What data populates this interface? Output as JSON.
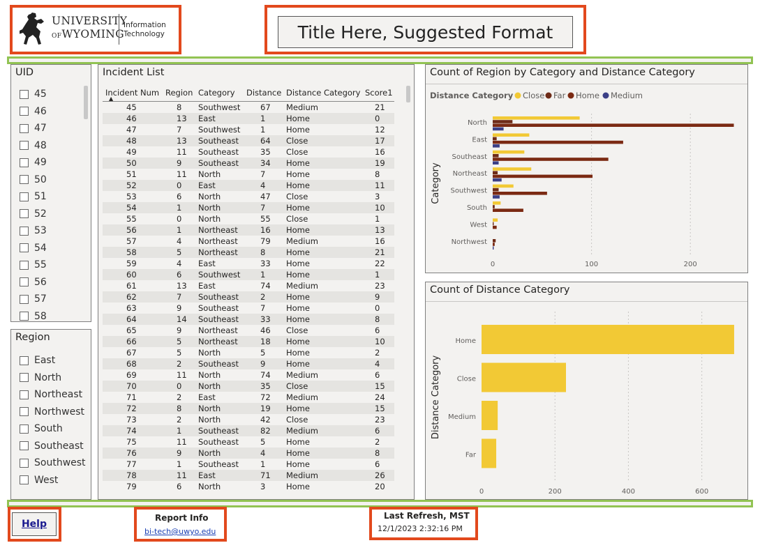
{
  "header": {
    "logo": {
      "line1": "UNIVERSITY",
      "line2_of": "OF",
      "line2": "WYOMING",
      "dept_line1": "Information",
      "dept_line2": "Technology"
    },
    "title": "Title Here, Suggested Format"
  },
  "uid_slicer": {
    "title": "UID",
    "items": [
      "45",
      "46",
      "47",
      "48",
      "49",
      "50",
      "51",
      "52",
      "53",
      "54",
      "55",
      "56",
      "57",
      "58"
    ]
  },
  "region_slicer": {
    "title": "Region",
    "items": [
      "East",
      "North",
      "Northeast",
      "Northwest",
      "South",
      "Southeast",
      "Southwest",
      "West"
    ]
  },
  "incident_list": {
    "title": "Incident List",
    "columns": [
      "Incident Num",
      "Region",
      "Category",
      "Distance",
      "Distance Category",
      "Score1"
    ],
    "sort_indicator": "▲",
    "rows": [
      [
        "45",
        "8",
        "Southwest",
        "67",
        "Medium",
        "21"
      ],
      [
        "46",
        "13",
        "East",
        "1",
        "Home",
        "0"
      ],
      [
        "47",
        "7",
        "Southwest",
        "1",
        "Home",
        "12"
      ],
      [
        "48",
        "13",
        "Southeast",
        "64",
        "Close",
        "17"
      ],
      [
        "49",
        "11",
        "Southeast",
        "35",
        "Close",
        "16"
      ],
      [
        "50",
        "9",
        "Southeast",
        "34",
        "Home",
        "19"
      ],
      [
        "51",
        "11",
        "North",
        "7",
        "Home",
        "8"
      ],
      [
        "52",
        "0",
        "East",
        "4",
        "Home",
        "11"
      ],
      [
        "53",
        "6",
        "North",
        "47",
        "Close",
        "3"
      ],
      [
        "54",
        "1",
        "North",
        "7",
        "Home",
        "10"
      ],
      [
        "55",
        "0",
        "North",
        "55",
        "Close",
        "1"
      ],
      [
        "56",
        "1",
        "Northeast",
        "16",
        "Home",
        "13"
      ],
      [
        "57",
        "4",
        "Northeast",
        "79",
        "Medium",
        "16"
      ],
      [
        "58",
        "5",
        "Northeast",
        "8",
        "Home",
        "21"
      ],
      [
        "59",
        "4",
        "East",
        "33",
        "Home",
        "22"
      ],
      [
        "60",
        "6",
        "Southwest",
        "1",
        "Home",
        "1"
      ],
      [
        "61",
        "13",
        "East",
        "74",
        "Medium",
        "23"
      ],
      [
        "62",
        "7",
        "Southeast",
        "2",
        "Home",
        "9"
      ],
      [
        "63",
        "9",
        "Southeast",
        "7",
        "Home",
        "0"
      ],
      [
        "64",
        "14",
        "Southeast",
        "33",
        "Home",
        "8"
      ],
      [
        "65",
        "9",
        "Northeast",
        "46",
        "Close",
        "6"
      ],
      [
        "66",
        "5",
        "Northeast",
        "18",
        "Home",
        "10"
      ],
      [
        "67",
        "5",
        "North",
        "5",
        "Home",
        "2"
      ],
      [
        "68",
        "2",
        "Southeast",
        "9",
        "Home",
        "4"
      ],
      [
        "69",
        "11",
        "North",
        "74",
        "Medium",
        "6"
      ],
      [
        "70",
        "0",
        "North",
        "35",
        "Close",
        "15"
      ],
      [
        "71",
        "2",
        "East",
        "72",
        "Medium",
        "24"
      ],
      [
        "72",
        "8",
        "North",
        "19",
        "Home",
        "15"
      ],
      [
        "73",
        "2",
        "North",
        "42",
        "Close",
        "23"
      ],
      [
        "74",
        "1",
        "Southeast",
        "82",
        "Medium",
        "6"
      ],
      [
        "75",
        "11",
        "Southeast",
        "5",
        "Home",
        "2"
      ],
      [
        "76",
        "9",
        "North",
        "4",
        "Home",
        "8"
      ],
      [
        "77",
        "1",
        "Southeast",
        "1",
        "Home",
        "6"
      ],
      [
        "78",
        "11",
        "East",
        "71",
        "Medium",
        "26"
      ],
      [
        "79",
        "6",
        "North",
        "3",
        "Home",
        "20"
      ]
    ]
  },
  "chart_data": [
    {
      "type": "bar",
      "orientation": "horizontal",
      "title": "Count of Region by Category and Distance Category",
      "legend_title": "Distance Category",
      "legend_position": "top-left",
      "ylabel": "Category",
      "xlabel": "",
      "xlim": [
        0,
        250
      ],
      "xticks": [
        0,
        100,
        200
      ],
      "grid": true,
      "categories": [
        "North",
        "East",
        "Southeast",
        "Northeast",
        "Southwest",
        "South",
        "West",
        "Northwest"
      ],
      "series": [
        {
          "name": "Close",
          "color": "#f2c935",
          "values": [
            88,
            37,
            32,
            39,
            21,
            8,
            5,
            0
          ]
        },
        {
          "name": "Far",
          "color": "#6e2b17",
          "values": [
            20,
            4,
            6,
            5,
            6,
            2,
            1,
            3
          ]
        },
        {
          "name": "Home",
          "color": "#7b2a13",
          "values": [
            244,
            132,
            117,
            101,
            55,
            31,
            4,
            2
          ]
        },
        {
          "name": "Medium",
          "color": "#3b3f86",
          "values": [
            11,
            7,
            6,
            9,
            7,
            0,
            0,
            1
          ]
        }
      ]
    },
    {
      "type": "bar",
      "orientation": "horizontal",
      "title": "Count of Distance Category",
      "ylabel": "Distance Category",
      "xlabel": "",
      "xlim": [
        0,
        690
      ],
      "xticks": [
        0,
        200,
        400,
        600
      ],
      "grid": true,
      "categories": [
        "Home",
        "Close",
        "Medium",
        "Far"
      ],
      "color": "#f2c935",
      "values": [
        688,
        230,
        44,
        40
      ]
    }
  ],
  "footer": {
    "help_label": "Help",
    "report_info_label": "Report Info",
    "report_info_email": "bi-tech@uwyo.edu",
    "last_refresh_label": "Last Refresh, MST",
    "last_refresh_value": "12/1/2023 2:32:16 PM"
  }
}
